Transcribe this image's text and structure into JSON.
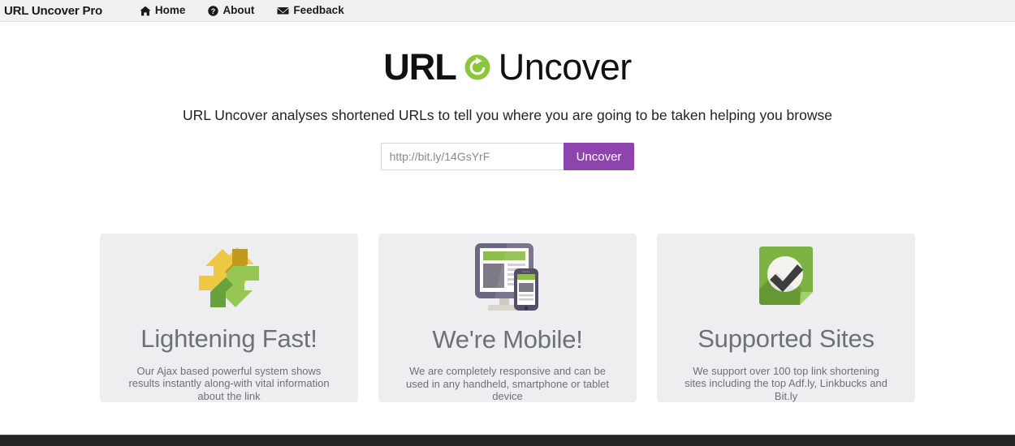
{
  "navbar": {
    "brand": "URL Uncover Pro",
    "links": [
      {
        "label": "Home",
        "icon": "home-icon"
      },
      {
        "label": "About",
        "icon": "question-circle-icon"
      },
      {
        "label": "Feedback",
        "icon": "envelope-icon"
      }
    ]
  },
  "hero": {
    "logo_primary": "URL",
    "logo_secondary": "Uncover",
    "logo_icon": "refresh-circle-icon",
    "tagline": "URL Uncover analyses shortened URLs to tell you where you are going to be taken helping you browse"
  },
  "search": {
    "placeholder": "http://bit.ly/14GsYrF",
    "value": "",
    "button_label": "Uncover"
  },
  "features": [
    {
      "icon": "recycle-arrows-icon",
      "title": "Lightening Fast!",
      "text": "Our Ajax based powerful system shows results instantly along-with vital information about the link"
    },
    {
      "icon": "responsive-devices-icon",
      "title": "We're Mobile!",
      "text": "We are completely responsive and can be used in any handheld, smartphone or tablet device"
    },
    {
      "icon": "green-check-badge-icon",
      "title": "Supported Sites",
      "text": "We support over 100 top link shortening sites including the top Adf.ly, Linkbucks and Bit.ly"
    }
  ],
  "colors": {
    "navbar_bg": "#f1f1f2",
    "accent_purple": "#8e44ad",
    "accent_green": "#8cc63e",
    "card_bg": "#eeeef0",
    "text_gray": "#6b7177",
    "footer_bg": "#252525"
  }
}
